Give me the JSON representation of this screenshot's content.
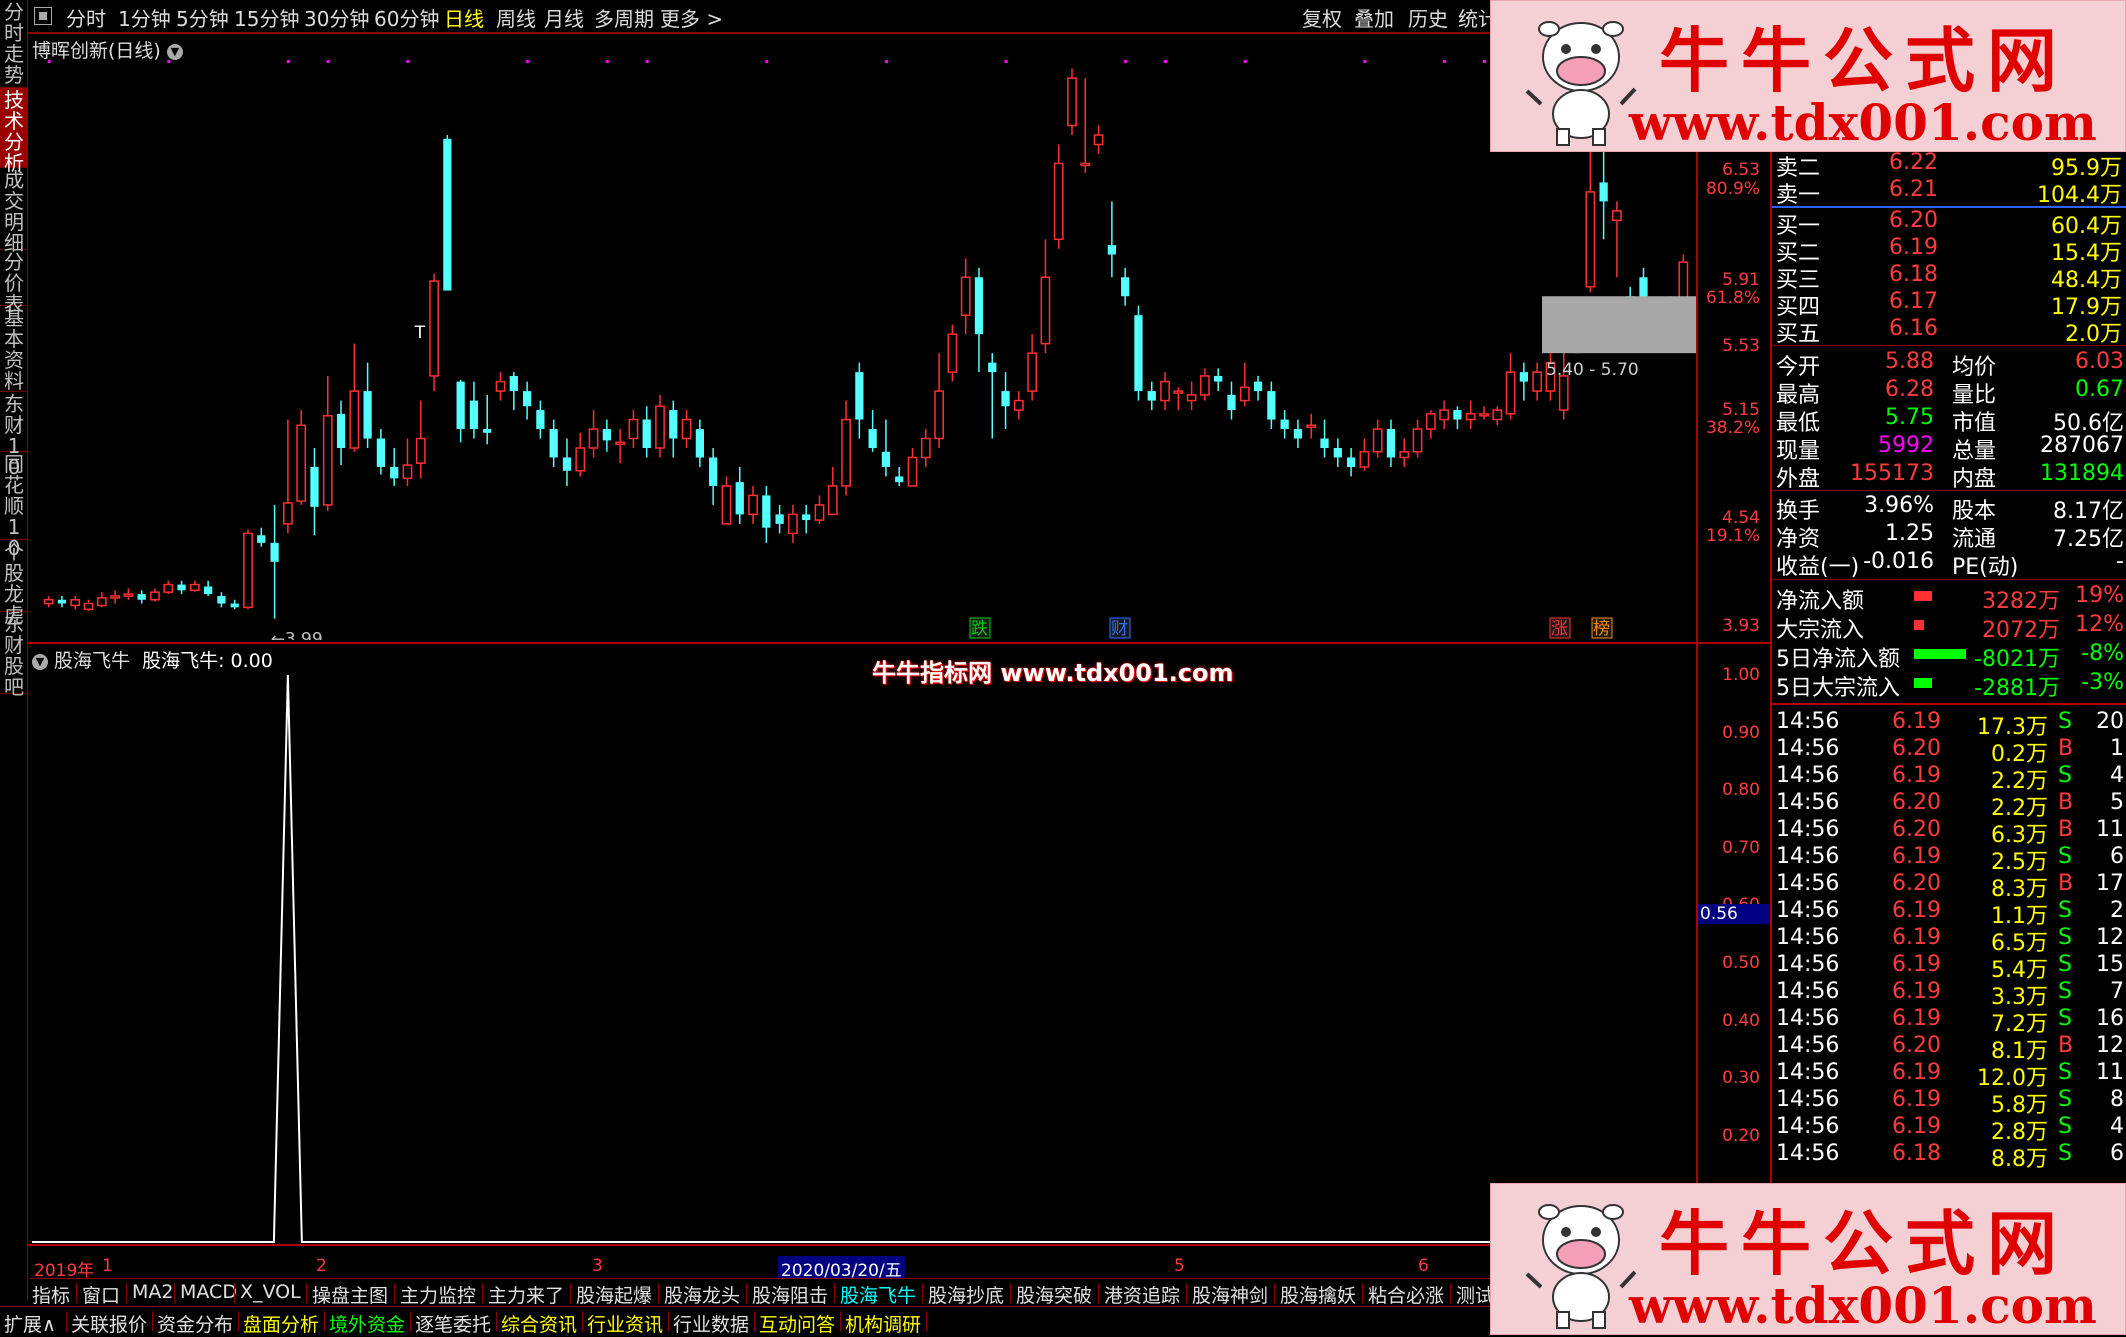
{
  "toolbar": {
    "items": [
      "分时",
      "1分钟",
      "5分钟",
      "15分钟",
      "30分钟",
      "60分钟",
      "日线",
      "周线",
      "月线",
      "多周期",
      "更多 >"
    ],
    "active_index": 6,
    "right_items": [
      "复权",
      "叠加",
      "历史",
      "统计"
    ]
  },
  "left_tabs": [
    "分时走势",
    "技术分析",
    "成交明细",
    "分价表",
    "基本资料",
    "东财10",
    "同花顺10",
    "个股龙虎",
    "东财股吧"
  ],
  "left_active_index": 1,
  "main_chart": {
    "title": "博晖创新(日线)",
    "y_labels": [
      {
        "value": "6.53",
        "pct": "80.9%"
      },
      {
        "value": "5.91",
        "pct": "61.8%"
      },
      {
        "value": "5.53",
        "pct": ""
      },
      {
        "value": "5.15",
        "pct": "38.2%"
      },
      {
        "value": "4.54",
        "pct": "19.1%"
      },
      {
        "value": "3.93",
        "pct": ""
      }
    ],
    "low_marker": "3.99",
    "t_marker": "T",
    "range_box_label": "5.40 - 5.70",
    "event_tags": [
      {
        "text": "跌",
        "color": "#00cc00"
      },
      {
        "text": "财",
        "color": "#3070ff"
      },
      {
        "text": "涨",
        "color": "#ff3030"
      },
      {
        "text": "榜",
        "color": "#ff8c00"
      }
    ]
  },
  "sub_chart": {
    "indicator_name": "股海飞牛",
    "readout": "股海飞牛: 0.00",
    "overlay_text": "牛牛指标网 www.tdx001.com",
    "y_labels": [
      "1.00",
      "0.90",
      "0.80",
      "0.70",
      "0.60",
      "0.50",
      "0.40",
      "0.30",
      "0.20"
    ],
    "current_value": "0.56"
  },
  "x_axis": {
    "labels": [
      "2019年",
      "1",
      "2",
      "3",
      "2020/03/20/五",
      "5",
      "6"
    ]
  },
  "chart_data": {
    "type": "candlestick",
    "title": "博晖创新(日线)",
    "ylim": [
      3.93,
      6.84
    ],
    "candles": [
      [
        4.08,
        4.1,
        4.06,
        4.12
      ],
      [
        4.1,
        4.08,
        4.06,
        4.12
      ],
      [
        4.07,
        4.1,
        4.05,
        4.12
      ],
      [
        4.05,
        4.08,
        4.04,
        4.1
      ],
      [
        4.07,
        4.11,
        4.06,
        4.14
      ],
      [
        4.11,
        4.12,
        4.08,
        4.15
      ],
      [
        4.12,
        4.13,
        4.1,
        4.16
      ],
      [
        4.13,
        4.1,
        4.08,
        4.15
      ],
      [
        4.1,
        4.14,
        4.09,
        4.16
      ],
      [
        4.14,
        4.18,
        4.13,
        4.2
      ],
      [
        4.18,
        4.15,
        4.13,
        4.2
      ],
      [
        4.15,
        4.18,
        4.14,
        4.2
      ],
      [
        4.17,
        4.13,
        4.12,
        4.2
      ],
      [
        4.12,
        4.08,
        4.06,
        4.14
      ],
      [
        4.08,
        4.06,
        4.05,
        4.1
      ],
      [
        4.06,
        4.45,
        4.05,
        4.47
      ],
      [
        4.44,
        4.4,
        4.38,
        4.48
      ],
      [
        4.4,
        4.3,
        4.0,
        4.6
      ],
      [
        4.5,
        4.61,
        4.45,
        5.05
      ],
      [
        4.62,
        5.02,
        4.6,
        5.1
      ],
      [
        4.8,
        4.59,
        4.44,
        4.9
      ],
      [
        4.6,
        5.07,
        4.57,
        5.28
      ],
      [
        5.08,
        4.9,
        4.81,
        5.15
      ],
      [
        4.9,
        5.2,
        4.88,
        5.45
      ],
      [
        5.2,
        4.95,
        4.9,
        5.35
      ],
      [
        4.95,
        4.8,
        4.76,
        5.0
      ],
      [
        4.8,
        4.74,
        4.7,
        4.9
      ],
      [
        4.74,
        4.81,
        4.7,
        4.95
      ],
      [
        4.82,
        4.95,
        4.74,
        5.15
      ],
      [
        5.28,
        5.78,
        5.2,
        5.82
      ],
      [
        6.53,
        5.73,
        5.73,
        6.55
      ],
      [
        5.25,
        5.0,
        4.93,
        5.26
      ],
      [
        5.15,
        5.0,
        4.95,
        5.25
      ],
      [
        5.0,
        4.98,
        4.92,
        5.18
      ],
      [
        5.2,
        5.25,
        5.15,
        5.3
      ],
      [
        5.28,
        5.2,
        5.1,
        5.3
      ],
      [
        5.2,
        5.12,
        5.05,
        5.25
      ],
      [
        5.1,
        5.0,
        4.95,
        5.15
      ],
      [
        5.0,
        4.85,
        4.8,
        5.05
      ],
      [
        4.85,
        4.78,
        4.7,
        4.95
      ],
      [
        4.78,
        4.9,
        4.75,
        4.98
      ],
      [
        4.9,
        5.0,
        4.85,
        5.1
      ],
      [
        5.0,
        4.94,
        4.88,
        5.05
      ],
      [
        4.93,
        4.93,
        4.82,
        5.0
      ],
      [
        4.95,
        5.05,
        4.9,
        5.1
      ],
      [
        5.05,
        4.9,
        4.85,
        5.12
      ],
      [
        4.9,
        5.12,
        4.85,
        5.18
      ],
      [
        5.1,
        4.95,
        4.85,
        5.15
      ],
      [
        4.95,
        5.05,
        4.9,
        5.1
      ],
      [
        5.0,
        4.85,
        4.8,
        5.05
      ],
      [
        4.85,
        4.7,
        4.6,
        4.9
      ],
      [
        4.5,
        4.7,
        4.5,
        4.75
      ],
      [
        4.72,
        4.55,
        4.5,
        4.8
      ],
      [
        4.55,
        4.65,
        4.5,
        4.7
      ],
      [
        4.65,
        4.48,
        4.4,
        4.7
      ],
      [
        4.55,
        4.5,
        4.45,
        4.6
      ],
      [
        4.45,
        4.55,
        4.4,
        4.6
      ],
      [
        4.55,
        4.52,
        4.45,
        4.6
      ],
      [
        4.52,
        4.6,
        4.5,
        4.65
      ],
      [
        4.55,
        4.7,
        4.55,
        4.8
      ],
      [
        4.7,
        5.05,
        4.65,
        5.15
      ],
      [
        5.3,
        5.05,
        4.95,
        5.35
      ],
      [
        5.0,
        4.9,
        4.88,
        5.1
      ],
      [
        4.88,
        4.8,
        4.75,
        5.05
      ],
      [
        4.75,
        4.72,
        4.7,
        4.8
      ],
      [
        4.7,
        4.85,
        4.7,
        4.9
      ],
      [
        4.85,
        4.95,
        4.8,
        5.0
      ],
      [
        4.95,
        5.2,
        4.9,
        5.4
      ],
      [
        5.3,
        5.5,
        5.25,
        5.55
      ],
      [
        5.6,
        5.8,
        5.5,
        5.9
      ],
      [
        5.8,
        5.5,
        5.3,
        5.85
      ],
      [
        5.35,
        5.3,
        4.95,
        5.4
      ],
      [
        5.2,
        5.12,
        5.0,
        5.3
      ],
      [
        5.1,
        5.15,
        5.05,
        5.2
      ],
      [
        5.2,
        5.4,
        5.15,
        5.5
      ],
      [
        5.45,
        5.8,
        5.4,
        6.0
      ],
      [
        6.0,
        6.4,
        5.95,
        6.5
      ],
      [
        6.6,
        6.85,
        6.55,
        6.9
      ],
      [
        6.4,
        6.4,
        6.35,
        6.85
      ],
      [
        6.5,
        6.55,
        6.45,
        6.6
      ],
      [
        5.97,
        5.92,
        5.8,
        6.2
      ],
      [
        5.8,
        5.7,
        5.65,
        5.85
      ],
      [
        5.6,
        5.2,
        5.15,
        5.65
      ],
      [
        5.2,
        5.15,
        5.1,
        5.25
      ],
      [
        5.15,
        5.25,
        5.1,
        5.3
      ],
      [
        5.2,
        5.2,
        5.1,
        5.22
      ],
      [
        5.15,
        5.18,
        5.1,
        5.25
      ],
      [
        5.18,
        5.28,
        5.15,
        5.32
      ],
      [
        5.28,
        5.25,
        5.2,
        5.32
      ],
      [
        5.18,
        5.1,
        5.05,
        5.25
      ],
      [
        5.15,
        5.22,
        5.12,
        5.35
      ],
      [
        5.25,
        5.2,
        5.15,
        5.28
      ],
      [
        5.2,
        5.05,
        5.0,
        5.25
      ],
      [
        5.05,
        5.0,
        4.95,
        5.1
      ],
      [
        5.0,
        4.95,
        4.9,
        5.05
      ],
      [
        5.02,
        5.02,
        4.95,
        5.08
      ],
      [
        4.95,
        4.9,
        4.85,
        5.05
      ],
      [
        4.9,
        4.85,
        4.8,
        4.95
      ],
      [
        4.85,
        4.8,
        4.75,
        4.9
      ],
      [
        4.8,
        4.88,
        4.78,
        4.95
      ],
      [
        4.88,
        5.0,
        4.85,
        5.05
      ],
      [
        5.0,
        4.85,
        4.8,
        5.05
      ],
      [
        4.85,
        4.88,
        4.8,
        4.95
      ],
      [
        4.88,
        5.0,
        4.85,
        5.05
      ],
      [
        5.0,
        5.08,
        4.95,
        5.1
      ],
      [
        5.05,
        5.1,
        5.0,
        5.15
      ],
      [
        5.1,
        5.05,
        5.0,
        5.12
      ],
      [
        5.05,
        5.08,
        5.0,
        5.15
      ],
      [
        5.08,
        5.08,
        5.05,
        5.12
      ],
      [
        5.05,
        5.1,
        5.02,
        5.12
      ],
      [
        5.08,
        5.3,
        5.05,
        5.4
      ],
      [
        5.3,
        5.25,
        5.15,
        5.35
      ],
      [
        5.2,
        5.3,
        5.15,
        5.35
      ],
      [
        5.2,
        5.35,
        5.15,
        5.4
      ],
      [
        5.1,
        5.28,
        5.05,
        5.45
      ],
      [
        5.45,
        5.4,
        5.4,
        5.45
      ],
      [
        5.75,
        6.25,
        5.72,
        6.85
      ],
      [
        6.3,
        6.2,
        6.0,
        6.5
      ],
      [
        6.1,
        6.15,
        5.8,
        6.2
      ],
      [
        5.7,
        5.62,
        5.55,
        5.75
      ],
      [
        5.8,
        5.65,
        5.6,
        5.85
      ],
      [
        5.6,
        5.58,
        5.45,
        5.65
      ],
      [
        5.55,
        5.62,
        5.5,
        5.7
      ],
      [
        5.6,
        5.88,
        5.55,
        5.92
      ]
    ],
    "event_tags": [
      "跌",
      "财",
      "涨",
      "榜"
    ],
    "range_box": [
      5.4,
      5.7
    ],
    "low_marker": 3.99
  },
  "indicator_data": {
    "type": "line",
    "name": "股海飞牛",
    "ylim": [
      0.0,
      1.0
    ],
    "spike_index": 18,
    "spike_value": 1.0,
    "current_value": 0.0
  },
  "right_panel": {
    "order_book": [
      {
        "label": "卖二",
        "price": "6.22",
        "vol": "95.9万"
      },
      {
        "label": "卖一",
        "price": "6.21",
        "vol": "104.4万"
      },
      {
        "label": "买一",
        "price": "6.20",
        "vol": "60.4万"
      },
      {
        "label": "买二",
        "price": "6.19",
        "vol": "15.4万"
      },
      {
        "label": "买三",
        "price": "6.18",
        "vol": "48.4万"
      },
      {
        "label": "买四",
        "price": "6.17",
        "vol": "17.9万"
      },
      {
        "label": "买五",
        "price": "6.16",
        "vol": "2.0万"
      }
    ],
    "stats": [
      {
        "l1": "今开",
        "v1": "5.88",
        "c1": "red",
        "l2": "均价",
        "v2": "6.03",
        "c2": "red"
      },
      {
        "l1": "最高",
        "v1": "6.28",
        "c1": "red",
        "l2": "量比",
        "v2": "0.67",
        "c2": "green"
      },
      {
        "l1": "最低",
        "v1": "5.75",
        "c1": "green",
        "l2": "市值",
        "v2": "50.6亿",
        "c2": "white"
      },
      {
        "l1": "现量",
        "v1": "5992",
        "c1": "magenta",
        "l2": "总量",
        "v2": "287067",
        "c2": "white"
      },
      {
        "l1": "外盘",
        "v1": "155173",
        "c1": "red",
        "l2": "内盘",
        "v2": "131894",
        "c2": "green"
      },
      {
        "l1": "换手",
        "v1": "3.96%",
        "c1": "white",
        "l2": "股本",
        "v2": "8.17亿",
        "c2": "white"
      },
      {
        "l1": "净资",
        "v1": "1.25",
        "c1": "white",
        "l2": "流通",
        "v2": "7.25亿",
        "c2": "white"
      },
      {
        "l1": "收益(一)",
        "v1": "-0.016",
        "c1": "white",
        "l2": "PE(动)",
        "v2": "-",
        "c2": "white"
      }
    ],
    "flows": [
      {
        "label": "净流入额",
        "bar_color": "#ff3030",
        "bar_w": 18,
        "value": "3282万",
        "pct": "19%",
        "color": "red"
      },
      {
        "label": "大宗流入",
        "bar_color": "#ff3030",
        "bar_w": 10,
        "value": "2072万",
        "pct": "12%",
        "color": "red"
      },
      {
        "label": "5日净流入额",
        "bar_color": "#00ff00",
        "bar_w": 52,
        "value": "-8021万",
        "pct": "-8%",
        "color": "green"
      },
      {
        "label": "5日大宗流入",
        "bar_color": "#00ff00",
        "bar_w": 18,
        "value": "-2881万",
        "pct": "-3%",
        "color": "green"
      }
    ],
    "ticks": [
      {
        "t": "14:56",
        "p": "6.19",
        "v": "17.3万",
        "bs": "S",
        "n": "20"
      },
      {
        "t": "14:56",
        "p": "6.20",
        "v": "0.2万",
        "bs": "B",
        "n": "1"
      },
      {
        "t": "14:56",
        "p": "6.19",
        "v": "2.2万",
        "bs": "S",
        "n": "4"
      },
      {
        "t": "14:56",
        "p": "6.20",
        "v": "2.2万",
        "bs": "B",
        "n": "5"
      },
      {
        "t": "14:56",
        "p": "6.20",
        "v": "6.3万",
        "bs": "B",
        "n": "11"
      },
      {
        "t": "14:56",
        "p": "6.19",
        "v": "2.5万",
        "bs": "S",
        "n": "6"
      },
      {
        "t": "14:56",
        "p": "6.20",
        "v": "8.3万",
        "bs": "B",
        "n": "17"
      },
      {
        "t": "14:56",
        "p": "6.19",
        "v": "1.1万",
        "bs": "S",
        "n": "2"
      },
      {
        "t": "14:56",
        "p": "6.19",
        "v": "6.5万",
        "bs": "S",
        "n": "12"
      },
      {
        "t": "14:56",
        "p": "6.19",
        "v": "5.4万",
        "bs": "S",
        "n": "15"
      },
      {
        "t": "14:56",
        "p": "6.19",
        "v": "3.3万",
        "bs": "S",
        "n": "7"
      },
      {
        "t": "14:56",
        "p": "6.19",
        "v": "7.2万",
        "bs": "S",
        "n": "16"
      },
      {
        "t": "14:56",
        "p": "6.20",
        "v": "8.1万",
        "bs": "B",
        "n": "12"
      },
      {
        "t": "14:56",
        "p": "6.19",
        "v": "12.0万",
        "bs": "S",
        "n": "11"
      },
      {
        "t": "14:56",
        "p": "6.19",
        "v": "5.8万",
        "bs": "S",
        "n": "8"
      },
      {
        "t": "14:56",
        "p": "6.19",
        "v": "2.8万",
        "bs": "S",
        "n": "4"
      },
      {
        "t": "14:56",
        "p": "6.18",
        "v": "8.8万",
        "bs": "S",
        "n": "6"
      }
    ]
  },
  "bottom_tabs": [
    "指标",
    "窗口",
    "MA2",
    "MACD",
    "X_VOL",
    "操盘主图",
    "主力监控",
    "主力来了",
    "股海起爆",
    "股海龙头",
    "股海阻击",
    "股海飞牛",
    "股海抄底",
    "股海突破",
    "港资追踪",
    "股海神剑",
    "股海擒妖",
    "粘合必涨",
    "测试主图",
    "测"
  ],
  "bottom_active_index": 11,
  "bottom_tabs2": [
    {
      "text": "扩展∧",
      "color": "#e0e0e0"
    },
    {
      "text": "关联报价",
      "color": "#e0e0e0"
    },
    {
      "text": "资金分布",
      "color": "#e0e0e0"
    },
    {
      "text": "盘面分析",
      "color": "#ffff00"
    },
    {
      "text": "境外资金",
      "color": "#00ff00"
    },
    {
      "text": "逐笔委托",
      "color": "#e0e0e0"
    },
    {
      "text": "综合资讯",
      "color": "#ffff00"
    },
    {
      "text": "行业资讯",
      "color": "#ffff00"
    },
    {
      "text": "行业数据",
      "color": "#e0e0e0"
    },
    {
      "text": "互动问答",
      "color": "#ffff00"
    },
    {
      "text": "机构调研",
      "color": "#ffff00"
    }
  ],
  "watermark": {
    "brand": "牛牛公式网",
    "url": "www.tdx001.com"
  }
}
